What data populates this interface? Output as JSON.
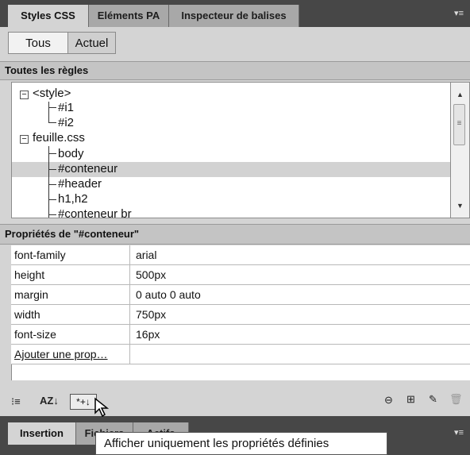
{
  "tabs": [
    "Styles CSS",
    "Eléments PA",
    "Inspecteur de balises"
  ],
  "panel_menu_icon": "panel-menu-icon",
  "filter": {
    "all": "Tous",
    "current": "Actuel"
  },
  "rules_header": "Toutes les règles",
  "tree": {
    "style": "<style>",
    "i1": "#i1",
    "i2": "#i2",
    "sheet": "feuille.css",
    "body": "body",
    "conteneur": "#conteneur",
    "header": "#header",
    "h1h2": "h1,h2",
    "partial": "#conteneur br"
  },
  "props_header": "Propriétés de \"#conteneur\"",
  "properties": [
    {
      "name": "font-family",
      "value": "arial"
    },
    {
      "name": "height",
      "value": "500px"
    },
    {
      "name": "margin",
      "value": "0 auto 0 auto"
    },
    {
      "name": "width",
      "value": "750px"
    },
    {
      "name": "font-size",
      "value": "16px"
    }
  ],
  "add_property": "Ajouter une prop…",
  "toolbar": {
    "category_view": "⁝≡",
    "alpha_view": "AZ↓",
    "set_only": "*+↓",
    "link_icon": "link-icon",
    "new_rule_icon": "new-rule-icon",
    "edit_icon": "edit-icon",
    "delete_icon": "delete-icon"
  },
  "bottom_tabs": {
    "insert": "Insertion",
    "files": "Fichiers",
    "assets": "Actifs"
  },
  "tooltip": "Afficher uniquement les propriétés définies",
  "colors": {
    "tab_bar": "#474747",
    "panel": "#d4d4d4",
    "selection": "#d2d2d2"
  }
}
